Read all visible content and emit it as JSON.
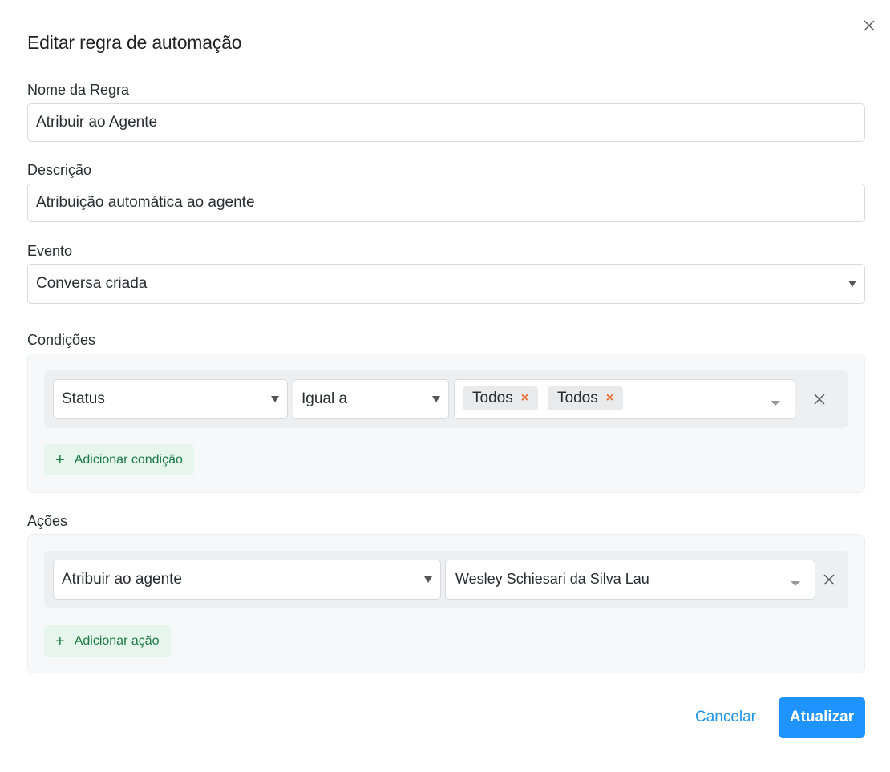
{
  "dialog": {
    "title": "Editar regra de automação",
    "close_icon": "close-icon"
  },
  "fields": {
    "name_label": "Nome da Regra",
    "name_value": "Atribuir ao Agente",
    "description_label": "Descrição",
    "description_value": "Atribuição automática ao agente",
    "event_label": "Evento",
    "event_value": "Conversa criada"
  },
  "conditions": {
    "label": "Condições",
    "rows": [
      {
        "attribute": "Status",
        "operator": "Igual a",
        "values": [
          "Todos",
          "Todos"
        ]
      }
    ],
    "add_label": "Adicionar condição"
  },
  "actions": {
    "label": "Ações",
    "rows": [
      {
        "action": "Atribuir ao agente",
        "value": "Wesley Schiesari da Silva Lau"
      }
    ],
    "add_label": "Adicionar ação"
  },
  "footer": {
    "cancel_label": "Cancelar",
    "submit_label": "Atualizar"
  },
  "colors": {
    "primary": "#1f93ff",
    "add_button_bg": "#e6f6ec",
    "add_button_text": "#1d7a46",
    "tag_remove": "#e96a2f"
  }
}
